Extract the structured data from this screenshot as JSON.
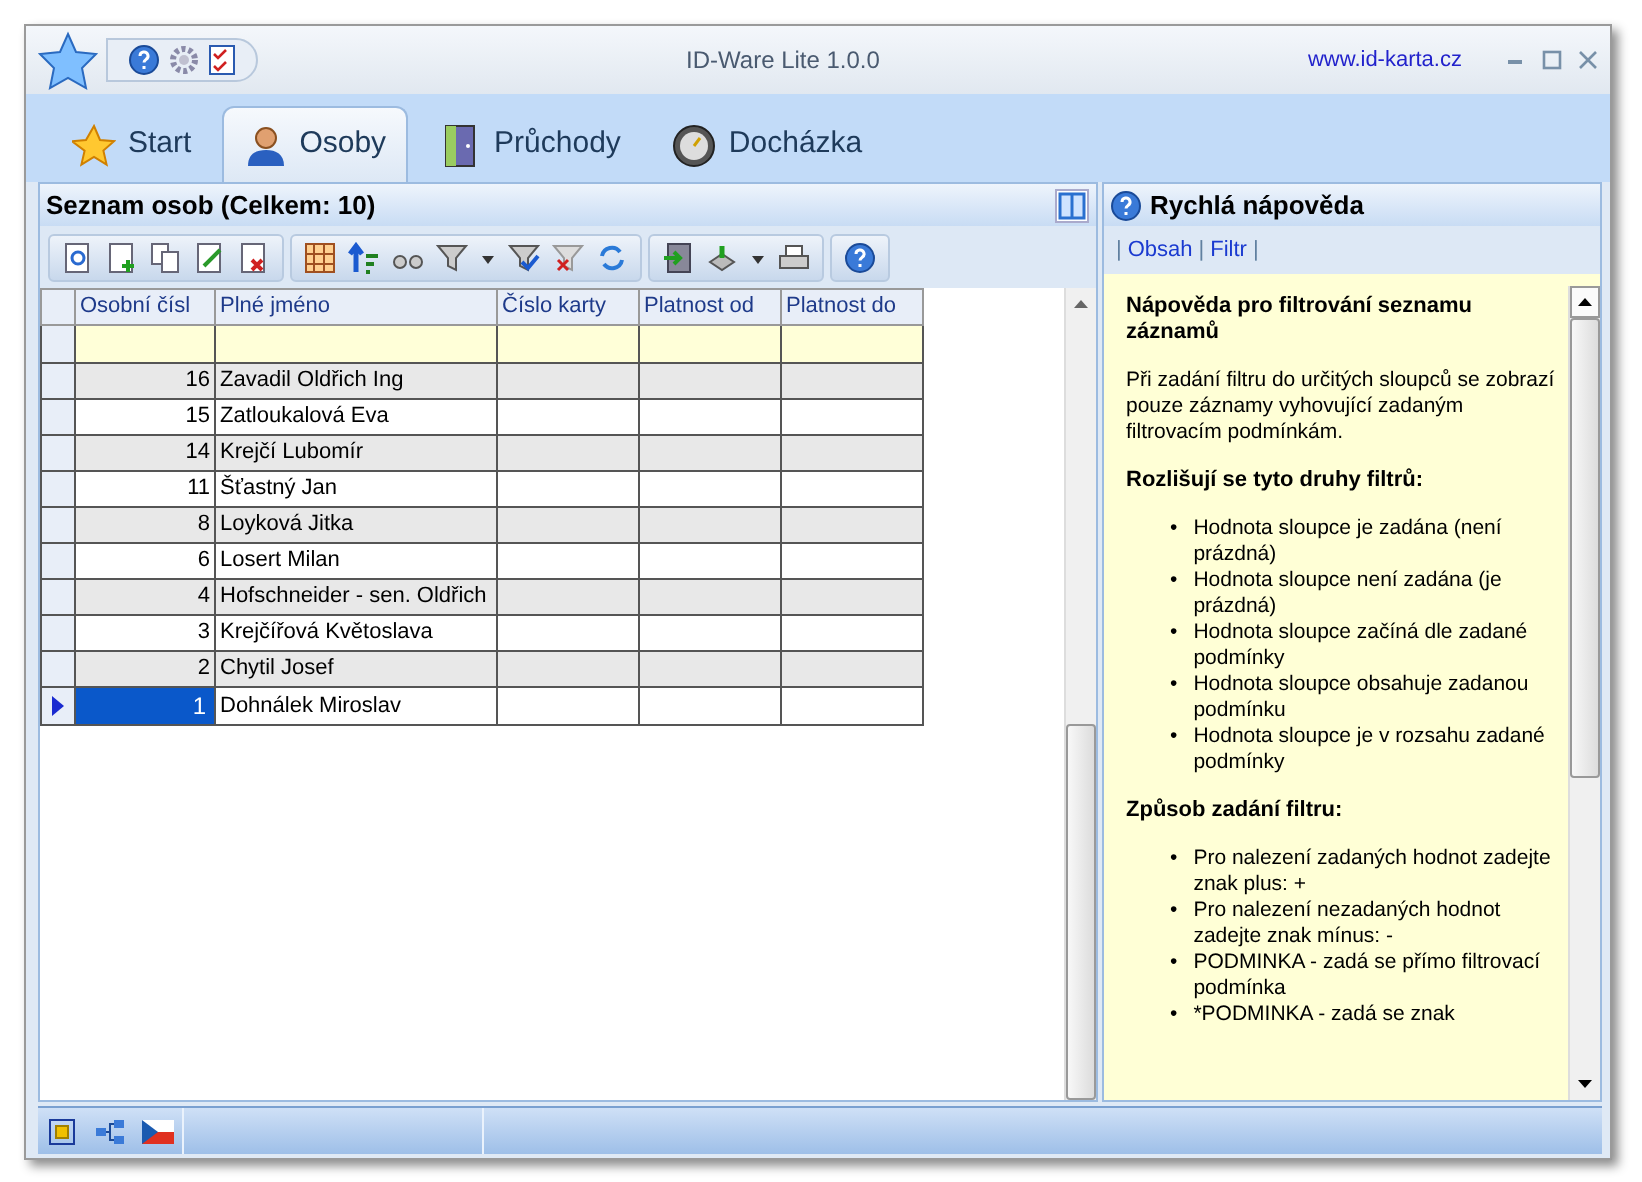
{
  "window": {
    "title": "ID-Ware Lite 1.0.0",
    "website": "www.id-karta.cz"
  },
  "tabs": [
    {
      "label": "Start",
      "selected": false
    },
    {
      "label": "Osoby",
      "selected": true
    },
    {
      "label": "Průchody",
      "selected": false
    },
    {
      "label": "Docházka",
      "selected": false
    }
  ],
  "person_list": {
    "title": "Seznam osob (Celkem: 10)",
    "columns": [
      "Osobní čísl",
      "Plné jméno",
      "Číslo karty",
      "Platnost od",
      "Platnost do"
    ],
    "rows": [
      {
        "number": "16",
        "name": "Zavadil  Oldřich Ing",
        "selected": false
      },
      {
        "number": "15",
        "name": "Zatloukalová Eva",
        "selected": false
      },
      {
        "number": "14",
        "name": "Krejčí Lubomír",
        "selected": false
      },
      {
        "number": "11",
        "name": "Šťastný  Jan",
        "selected": false
      },
      {
        "number": "8",
        "name": "Loyková Jitka",
        "selected": false
      },
      {
        "number": "6",
        "name": "Losert   Milan",
        "selected": false
      },
      {
        "number": "4",
        "name": "Hofschneider - sen. Oldřich",
        "selected": false
      },
      {
        "number": "3",
        "name": "Krejčířová Květoslava",
        "selected": false
      },
      {
        "number": "2",
        "name": "Chytil  Josef",
        "selected": false
      },
      {
        "number": "1",
        "name": "Dohnálek  Miroslav",
        "selected": true
      }
    ]
  },
  "help_panel": {
    "title": "Rychlá nápověda",
    "separator": "|",
    "links": [
      "Obsah",
      "Filtr"
    ],
    "blocks": [
      {
        "kind": "heading",
        "text": "Nápověda pro filtrování seznamu záznamů"
      },
      {
        "kind": "paragraph",
        "text": "Při zadání filtru do určitých sloupců se zobrazí pouze záznamy vyhovující zadaným filtrovacím podmínkám."
      },
      {
        "kind": "heading",
        "text": "Rozlišují se tyto druhy filtrů:"
      },
      {
        "kind": "list",
        "marker": "•",
        "items": [
          "Hodnota sloupce je zadána (není prázdná)",
          "Hodnota sloupce není zadána (je prázdná)",
          "Hodnota sloupce začíná dle zadané podmínky",
          "Hodnota sloupce obsahuje zadanou podmínku",
          "Hodnota sloupce je v rozsahu zadané podmínky"
        ]
      },
      {
        "kind": "heading",
        "text": "Způsob zadání filtru:"
      },
      {
        "kind": "list",
        "marker": "•",
        "items": [
          "Pro nalezení zadaných hodnot zadejte znak plus: +",
          "Pro nalezení nezadaných hodnot zadejte znak mínus: -",
          "PODMINKA - zadá se přímo filtrovací podmínka",
          "*PODMINKA - zadá se znak"
        ]
      }
    ]
  }
}
